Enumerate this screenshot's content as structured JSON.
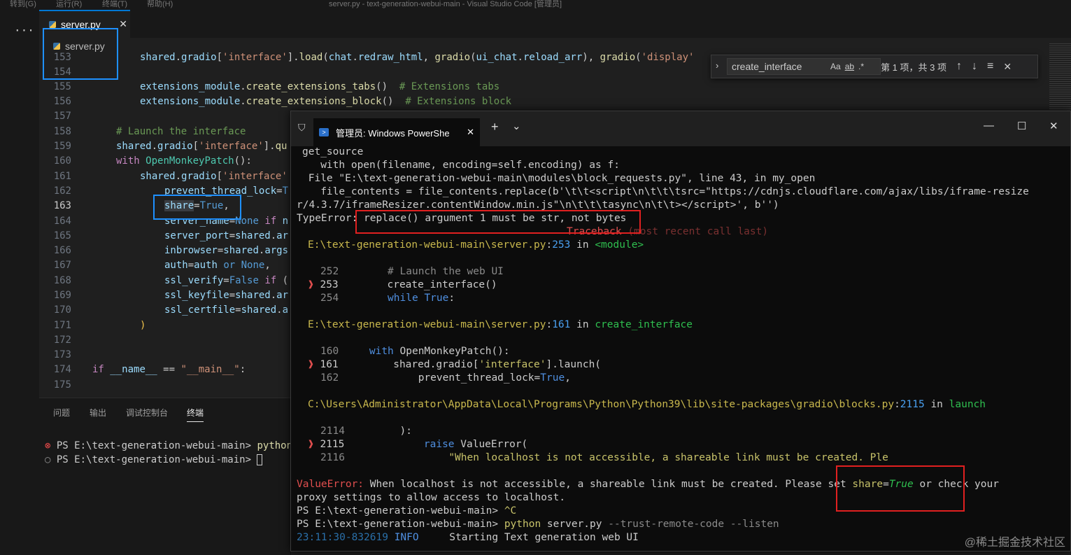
{
  "window": {
    "title_fragments": [
      "转到(G)",
      "运行(R)",
      "终端(T)",
      "帮助(H)",
      "server.py - text-generation-webui-main - Visual Studio Code [管理员]"
    ]
  },
  "editor": {
    "tab_label": "server.py",
    "tab_close": "✕",
    "breadcrumb_file": "server.py",
    "dots": "···"
  },
  "find_widget": {
    "query": "create_interface",
    "match_case": "Aa",
    "whole_word": "ab",
    "regex": ".*",
    "result": "第 1 项，共 3 项",
    "prev": "↑",
    "next": "↓",
    "selection": "≡",
    "close": "✕"
  },
  "code_lines": [
    {
      "n": "153"
    },
    {
      "n": "154"
    },
    {
      "n": "155"
    },
    {
      "n": "156"
    },
    {
      "n": "157"
    },
    {
      "n": "158"
    },
    {
      "n": "159"
    },
    {
      "n": "160"
    },
    {
      "n": "161"
    },
    {
      "n": "162"
    },
    {
      "n": "163"
    },
    {
      "n": "164"
    },
    {
      "n": "165"
    },
    {
      "n": "166"
    },
    {
      "n": "167"
    },
    {
      "n": "168"
    },
    {
      "n": "169"
    },
    {
      "n": "170"
    },
    {
      "n": "171"
    },
    {
      "n": "172"
    },
    {
      "n": "173"
    },
    {
      "n": "174"
    },
    {
      "n": "175"
    }
  ],
  "panel": {
    "tabs": [
      "问题",
      "输出",
      "调试控制台",
      "终端"
    ],
    "line1_prompt": "PS E:\\text-generation-webui-main>",
    "line1_cmd": "python s",
    "line2_prompt": "PS E:\\text-generation-webui-main>",
    "error_mark": "⊗",
    "ok_mark": "○"
  },
  "powershell": {
    "tab_title": "管理员: Windows PowerShe",
    "new_tab": "+",
    "dropdown": "⌄",
    "minimize": "—",
    "maximize": "☐",
    "close": "✕"
  },
  "watermark": "@稀土掘金技术社区"
}
